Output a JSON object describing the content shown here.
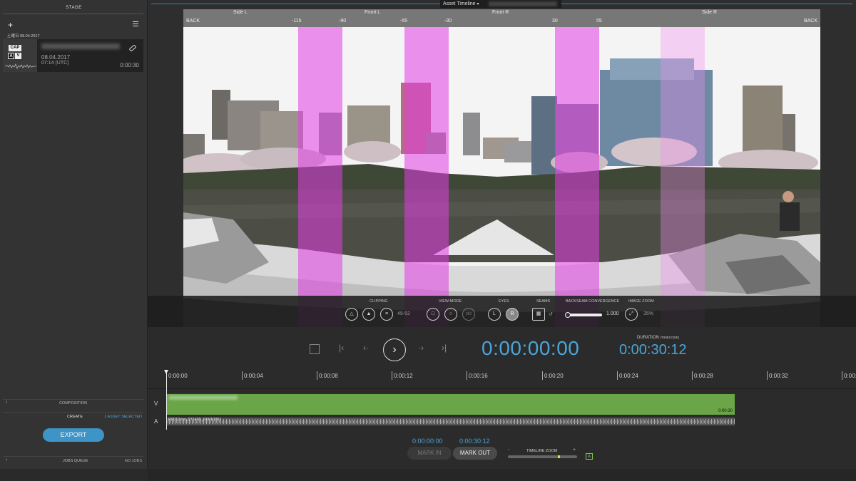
{
  "left_panel": {
    "title": "STAGE",
    "add_label": "+",
    "day_label": "土曜日 08.04.2017",
    "asset": {
      "cap_badge": "CAP",
      "a_badge": "A",
      "v_badge": "V",
      "date": "08.04.2017",
      "time": "07:14 (UTC)",
      "duration": "0:00:30"
    },
    "composition_label": "COMPOSITION",
    "create_label": "CREATE",
    "assets_selected": "1 ASSET SELECTED",
    "export_label": "EXPORT",
    "jobs_label": "JOBS QUEUE",
    "jobs_status": "NO JOBS"
  },
  "topbar": {
    "tab_label": "Asset Timeline"
  },
  "viewer": {
    "ruler_sections": [
      "Side L",
      "Front L",
      "Front R",
      "Side R"
    ],
    "ruler_left": "BACK",
    "ruler_right": "BACK",
    "ruler_ticks": [
      "-115",
      "-90",
      "-55",
      "-30",
      "30",
      "55"
    ],
    "controls": {
      "clipping_label": "CLIPPING",
      "clipping_value": "49-52",
      "viewmode_label": "VIEW-MODE",
      "viewmode_3": "360",
      "eyes_label": "EYES",
      "eye_left": "L",
      "eye_right": "R",
      "seams_label": "SEAMS",
      "backseam_label": "BACKSEAM CONVERGENCE",
      "backseam_value": "1.000",
      "zoom_label": "IMAGE ZOOM",
      "zoom_value": "35%"
    }
  },
  "transport": {
    "current_time": "0:00:00:00",
    "duration_label": "DURATION",
    "duration_sub": "(TIMECODE)",
    "duration_time": "0:00:30:12"
  },
  "timeline": {
    "ticks": [
      "0:00:00",
      "0:00:04",
      "0:00:08",
      "0:00:12",
      "0:00:16",
      "0:00:20",
      "0:00:24",
      "0:00:28",
      "0:00:32",
      "0:00:3"
    ],
    "video_label": "V",
    "audio_label": "A",
    "video_end": "0:00:30",
    "audio_name": "R0010xxx_071430_R0010051"
  },
  "bottom": {
    "in_time": "0:00:00:00",
    "out_time": "0:00:30:12",
    "mark_in": "MARK IN",
    "mark_out": "MARK OUT",
    "zoom_label": "TIMELINE ZOOM",
    "zoom_minus": "-",
    "zoom_plus": "+",
    "zoom_badge": "A"
  },
  "colors": {
    "accent": "#4ba5d8",
    "video_track": "#6aa647",
    "seam_band": "#e43ce6"
  }
}
